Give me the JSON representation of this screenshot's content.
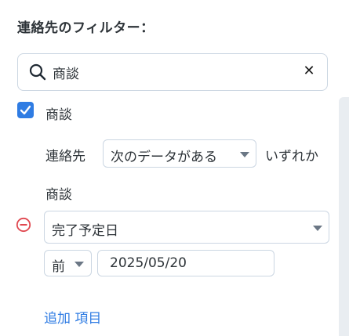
{
  "panel": {
    "title": "連絡先のフィルター："
  },
  "search": {
    "value": "商談",
    "search_icon": "search-icon",
    "clear_glyph": "✕"
  },
  "filter_group": {
    "checkbox_label": "商談",
    "checked": true,
    "object_label": "連絡先",
    "association_select": "次のデータがある",
    "quantifier_label": "いずれか",
    "sub_object_label": "商談",
    "property_select": "完了予定日",
    "operator_select": "前",
    "date_value": "2025/05/20",
    "remove_icon": "remove-circle-icon"
  },
  "actions": {
    "add_item": "追加 項目"
  },
  "colors": {
    "accent": "#2f7ce3",
    "danger": "#e0474f",
    "border": "#cbd6e2",
    "text": "#2d3338"
  }
}
